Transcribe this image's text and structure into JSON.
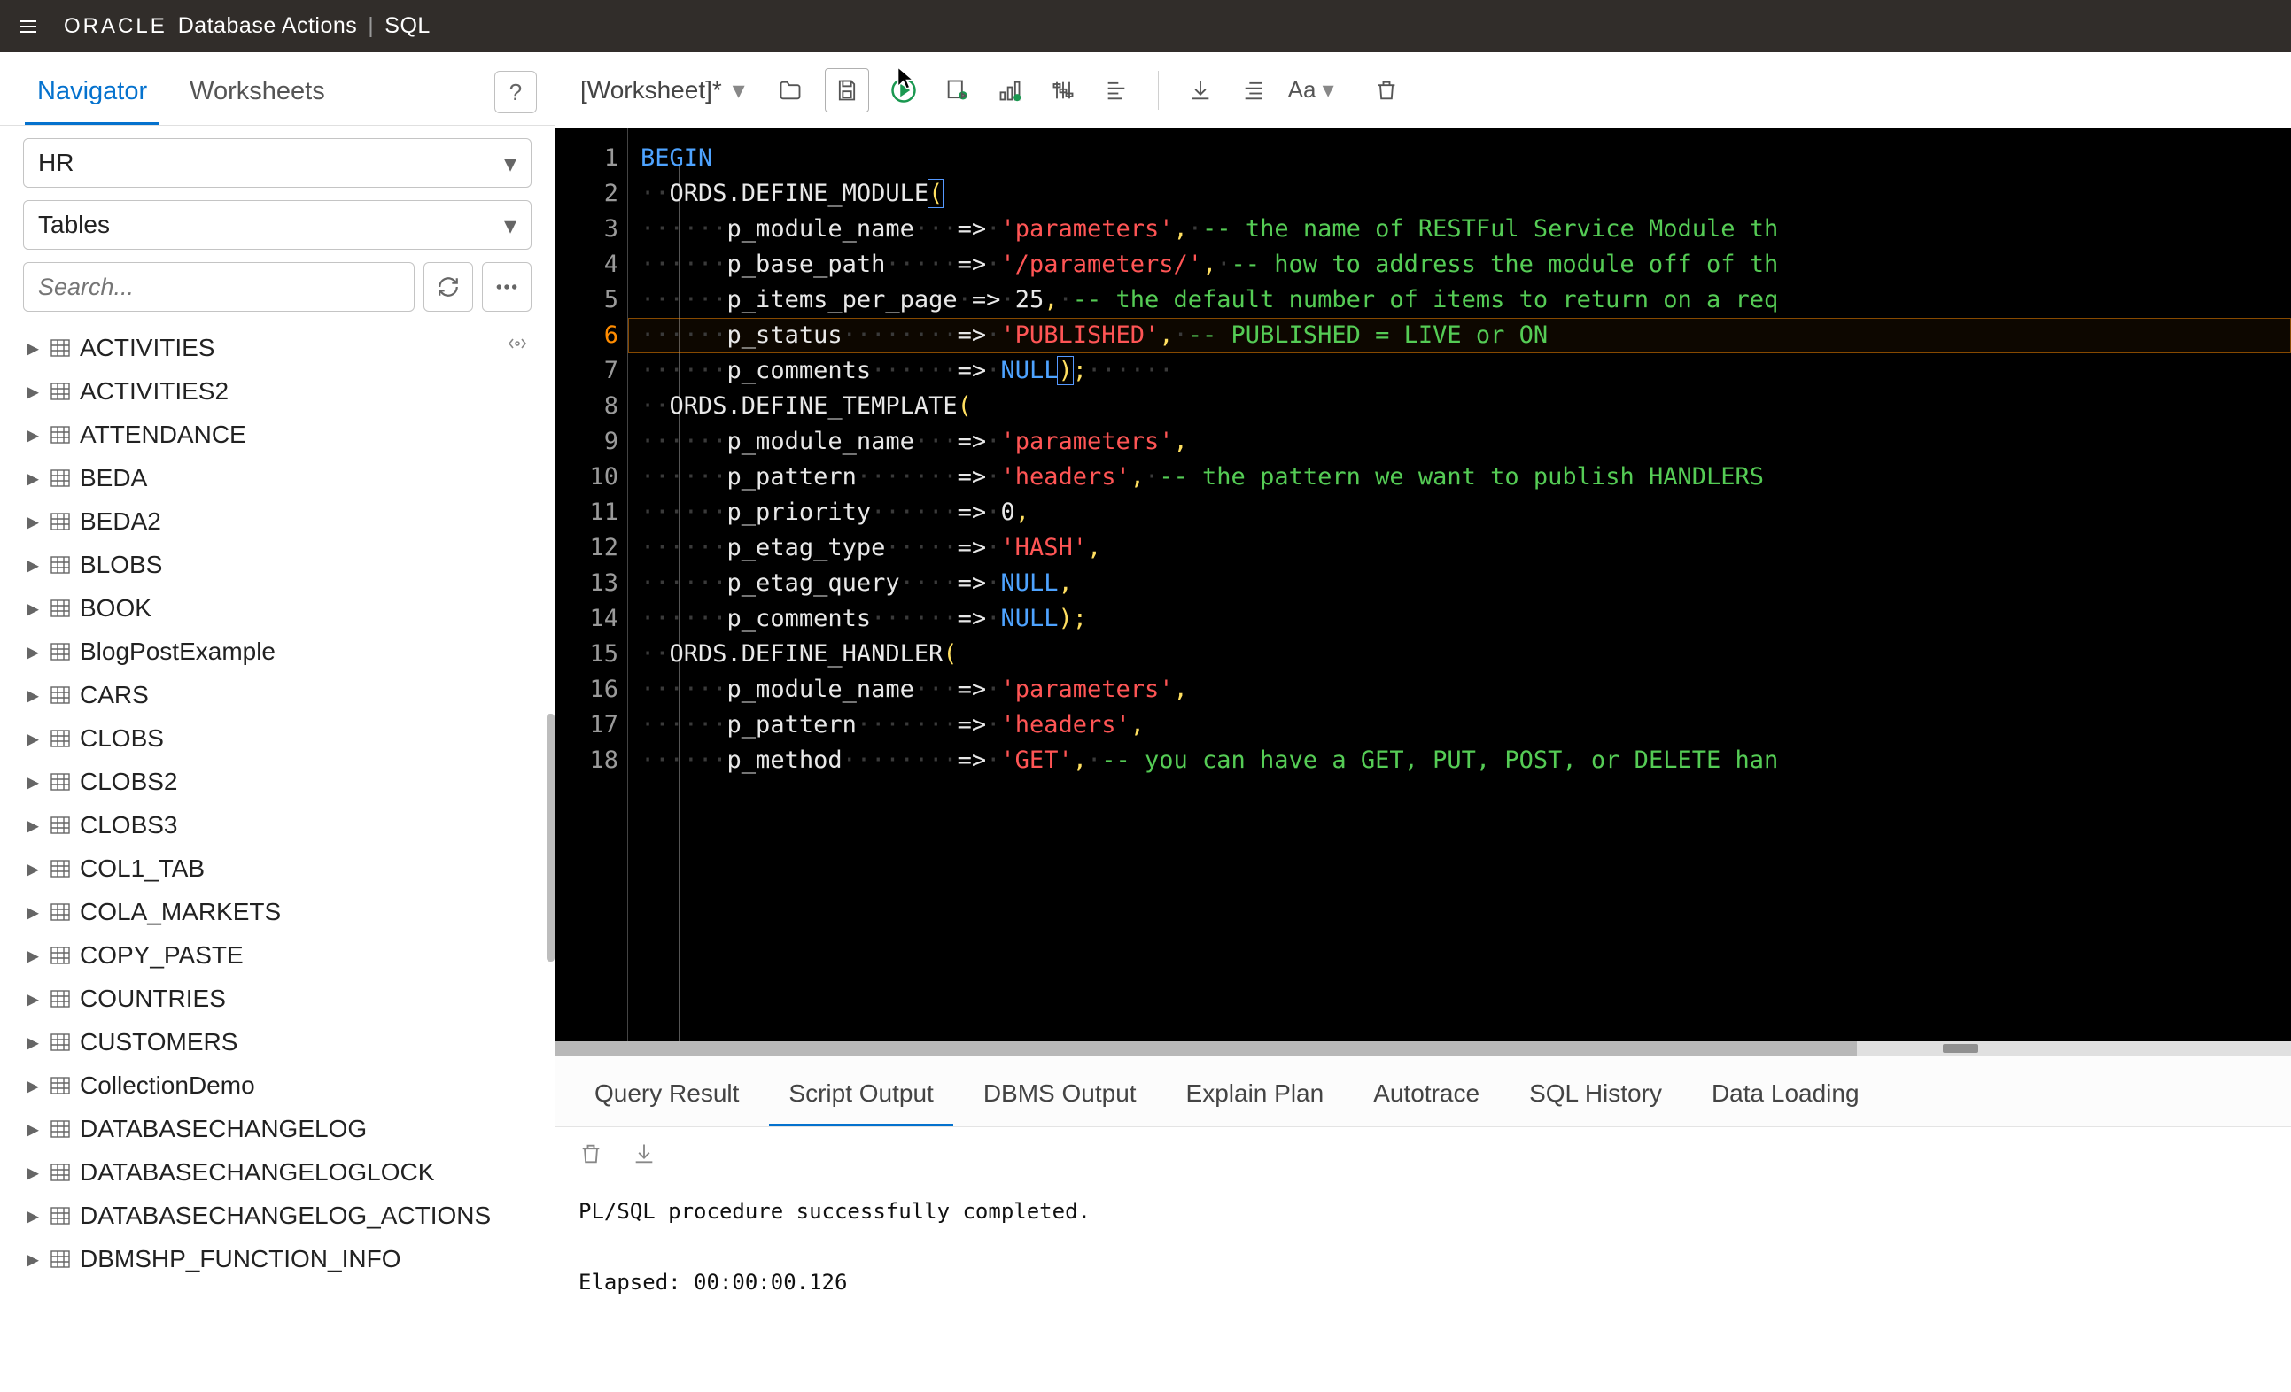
{
  "header": {
    "brand": "ORACLE",
    "product": "Database Actions",
    "page": "SQL"
  },
  "sidebar": {
    "tabs": {
      "navigator": "Navigator",
      "worksheets": "Worksheets"
    },
    "schema_selected": "HR",
    "object_type_selected": "Tables",
    "search_placeholder": "Search...",
    "tables": [
      "ACTIVITIES",
      "ACTIVITIES2",
      "ATTENDANCE",
      "BEDA",
      "BEDA2",
      "BLOBS",
      "BOOK",
      "BlogPostExample",
      "CARS",
      "CLOBS",
      "CLOBS2",
      "CLOBS3",
      "COL1_TAB",
      "COLA_MARKETS",
      "COPY_PASTE",
      "COUNTRIES",
      "CUSTOMERS",
      "CollectionDemo",
      "DATABASECHANGELOG",
      "DATABASECHANGELOGLOCK",
      "DATABASECHANGELOG_ACTIONS",
      "DBMSHP_FUNCTION_INFO"
    ]
  },
  "toolbar": {
    "worksheet_label": "[Worksheet]*",
    "font_label": "Aa"
  },
  "code": {
    "current_line": 6,
    "lines": [
      {
        "i": 1,
        "tokens": [
          {
            "c": "kw",
            "t": "BEGIN"
          }
        ]
      },
      {
        "i": 2,
        "tokens": [
          {
            "c": "ws",
            "t": "··"
          },
          {
            "c": "id",
            "t": "ORDS.DEFINE_MODULE"
          },
          {
            "c": "pu",
            "t": "(",
            "m": true
          }
        ]
      },
      {
        "i": 3,
        "tokens": [
          {
            "c": "ws",
            "t": "······"
          },
          {
            "c": "id",
            "t": "p_module_name"
          },
          {
            "c": "ws",
            "t": "···"
          },
          {
            "c": "op",
            "t": "=>"
          },
          {
            "c": "ws",
            "t": "·"
          },
          {
            "c": "str",
            "t": "'parameters'"
          },
          {
            "c": "pu",
            "t": ","
          },
          {
            "c": "ws",
            "t": "·"
          },
          {
            "c": "cm",
            "t": "-- the name of RESTFul Service Module th"
          }
        ]
      },
      {
        "i": 4,
        "tokens": [
          {
            "c": "ws",
            "t": "······"
          },
          {
            "c": "id",
            "t": "p_base_path"
          },
          {
            "c": "ws",
            "t": "·····"
          },
          {
            "c": "op",
            "t": "=>"
          },
          {
            "c": "ws",
            "t": "·"
          },
          {
            "c": "str",
            "t": "'/parameters/'"
          },
          {
            "c": "pu",
            "t": ","
          },
          {
            "c": "ws",
            "t": "·"
          },
          {
            "c": "cm",
            "t": "-- how to address the module off of th"
          }
        ]
      },
      {
        "i": 5,
        "tokens": [
          {
            "c": "ws",
            "t": "······"
          },
          {
            "c": "id",
            "t": "p_items_per_page"
          },
          {
            "c": "ws",
            "t": "·"
          },
          {
            "c": "op",
            "t": "=>"
          },
          {
            "c": "ws",
            "t": "·"
          },
          {
            "c": "num",
            "t": "25"
          },
          {
            "c": "pu",
            "t": ","
          },
          {
            "c": "ws",
            "t": "·"
          },
          {
            "c": "cm",
            "t": "-- the default number of items to return on a req"
          }
        ]
      },
      {
        "i": 6,
        "tokens": [
          {
            "c": "ws",
            "t": "······"
          },
          {
            "c": "id",
            "t": "p_status"
          },
          {
            "c": "ws",
            "t": "········"
          },
          {
            "c": "op",
            "t": "=>"
          },
          {
            "c": "ws",
            "t": "·"
          },
          {
            "c": "str",
            "t": "'PUBLISHED'"
          },
          {
            "c": "pu",
            "t": ","
          },
          {
            "c": "ws",
            "t": "·"
          },
          {
            "c": "cm",
            "t": "-- PUBLISHED = LIVE or ON"
          }
        ]
      },
      {
        "i": 7,
        "tokens": [
          {
            "c": "ws",
            "t": "······"
          },
          {
            "c": "id",
            "t": "p_comments"
          },
          {
            "c": "ws",
            "t": "······"
          },
          {
            "c": "op",
            "t": "=>"
          },
          {
            "c": "ws",
            "t": "·"
          },
          {
            "c": "null",
            "t": "NULL"
          },
          {
            "c": "pu",
            "t": ")",
            "m": true
          },
          {
            "c": "pu",
            "t": ";"
          },
          {
            "c": "ws",
            "t": "······"
          }
        ]
      },
      {
        "i": 8,
        "tokens": [
          {
            "c": "ws",
            "t": "··"
          },
          {
            "c": "id",
            "t": "ORDS.DEFINE_TEMPLATE"
          },
          {
            "c": "pu",
            "t": "("
          }
        ]
      },
      {
        "i": 9,
        "tokens": [
          {
            "c": "ws",
            "t": "······"
          },
          {
            "c": "id",
            "t": "p_module_name"
          },
          {
            "c": "ws",
            "t": "···"
          },
          {
            "c": "op",
            "t": "=>"
          },
          {
            "c": "ws",
            "t": "·"
          },
          {
            "c": "str",
            "t": "'parameters'"
          },
          {
            "c": "pu",
            "t": ","
          }
        ]
      },
      {
        "i": 10,
        "tokens": [
          {
            "c": "ws",
            "t": "······"
          },
          {
            "c": "id",
            "t": "p_pattern"
          },
          {
            "c": "ws",
            "t": "·······"
          },
          {
            "c": "op",
            "t": "=>"
          },
          {
            "c": "ws",
            "t": "·"
          },
          {
            "c": "str",
            "t": "'headers'"
          },
          {
            "c": "pu",
            "t": ","
          },
          {
            "c": "ws",
            "t": "·"
          },
          {
            "c": "cm",
            "t": "-- the pattern we want to publish HANDLERS "
          }
        ]
      },
      {
        "i": 11,
        "tokens": [
          {
            "c": "ws",
            "t": "······"
          },
          {
            "c": "id",
            "t": "p_priority"
          },
          {
            "c": "ws",
            "t": "······"
          },
          {
            "c": "op",
            "t": "=>"
          },
          {
            "c": "ws",
            "t": "·"
          },
          {
            "c": "num",
            "t": "0"
          },
          {
            "c": "pu",
            "t": ","
          }
        ]
      },
      {
        "i": 12,
        "tokens": [
          {
            "c": "ws",
            "t": "······"
          },
          {
            "c": "id",
            "t": "p_etag_type"
          },
          {
            "c": "ws",
            "t": "·····"
          },
          {
            "c": "op",
            "t": "=>"
          },
          {
            "c": "ws",
            "t": "·"
          },
          {
            "c": "str",
            "t": "'HASH'"
          },
          {
            "c": "pu",
            "t": ","
          }
        ]
      },
      {
        "i": 13,
        "tokens": [
          {
            "c": "ws",
            "t": "······"
          },
          {
            "c": "id",
            "t": "p_etag_query"
          },
          {
            "c": "ws",
            "t": "····"
          },
          {
            "c": "op",
            "t": "=>"
          },
          {
            "c": "ws",
            "t": "·"
          },
          {
            "c": "null",
            "t": "NULL"
          },
          {
            "c": "pu",
            "t": ","
          }
        ]
      },
      {
        "i": 14,
        "tokens": [
          {
            "c": "ws",
            "t": "······"
          },
          {
            "c": "id",
            "t": "p_comments"
          },
          {
            "c": "ws",
            "t": "······"
          },
          {
            "c": "op",
            "t": "=>"
          },
          {
            "c": "ws",
            "t": "·"
          },
          {
            "c": "null",
            "t": "NULL"
          },
          {
            "c": "pu",
            "t": ")"
          },
          {
            "c": "pu",
            "t": ";"
          }
        ]
      },
      {
        "i": 15,
        "tokens": [
          {
            "c": "ws",
            "t": "··"
          },
          {
            "c": "id",
            "t": "ORDS.DEFINE_HANDLER"
          },
          {
            "c": "pu",
            "t": "("
          }
        ]
      },
      {
        "i": 16,
        "tokens": [
          {
            "c": "ws",
            "t": "······"
          },
          {
            "c": "id",
            "t": "p_module_name"
          },
          {
            "c": "ws",
            "t": "···"
          },
          {
            "c": "op",
            "t": "=>"
          },
          {
            "c": "ws",
            "t": "·"
          },
          {
            "c": "str",
            "t": "'parameters'"
          },
          {
            "c": "pu",
            "t": ","
          }
        ]
      },
      {
        "i": 17,
        "tokens": [
          {
            "c": "ws",
            "t": "······"
          },
          {
            "c": "id",
            "t": "p_pattern"
          },
          {
            "c": "ws",
            "t": "·······"
          },
          {
            "c": "op",
            "t": "=>"
          },
          {
            "c": "ws",
            "t": "·"
          },
          {
            "c": "str",
            "t": "'headers'"
          },
          {
            "c": "pu",
            "t": ","
          }
        ]
      },
      {
        "i": 18,
        "tokens": [
          {
            "c": "ws",
            "t": "······"
          },
          {
            "c": "id",
            "t": "p_method"
          },
          {
            "c": "ws",
            "t": "········"
          },
          {
            "c": "op",
            "t": "=>"
          },
          {
            "c": "ws",
            "t": "·"
          },
          {
            "c": "str",
            "t": "'GET'"
          },
          {
            "c": "pu",
            "t": ","
          },
          {
            "c": "ws",
            "t": "·"
          },
          {
            "c": "cm",
            "t": "-- you can have a GET, PUT, POST, or DELETE han"
          }
        ]
      }
    ]
  },
  "results": {
    "tabs": {
      "query_result": "Query Result",
      "script_output": "Script Output",
      "dbms_output": "DBMS Output",
      "explain_plan": "Explain Plan",
      "autotrace": "Autotrace",
      "sql_history": "SQL History",
      "data_loading": "Data Loading"
    },
    "output_line1": "PL/SQL procedure successfully completed.",
    "output_line2": "Elapsed: 00:00:00.126"
  }
}
